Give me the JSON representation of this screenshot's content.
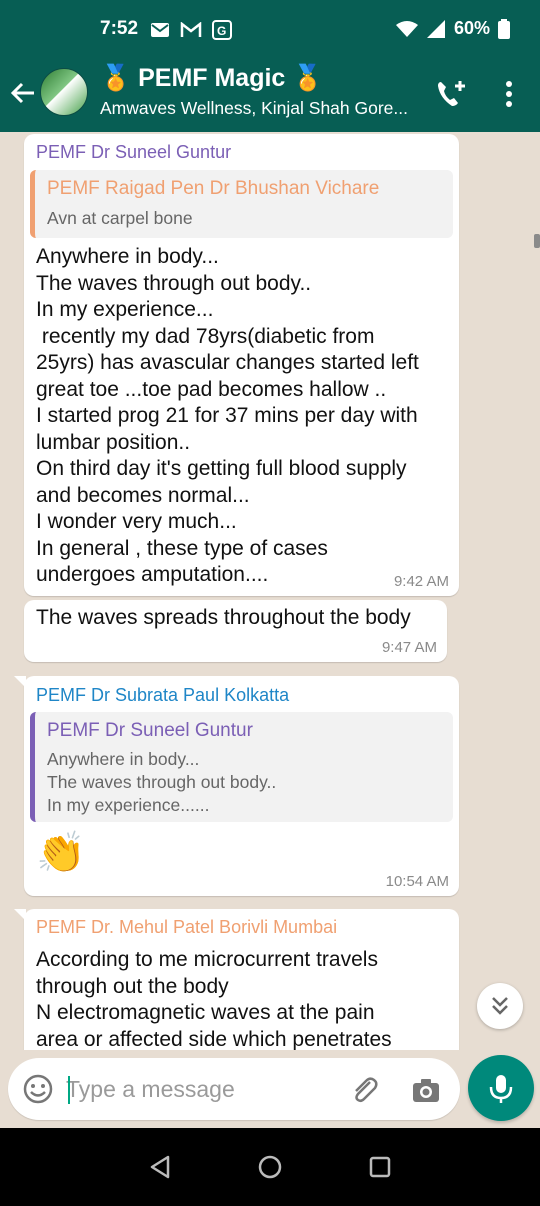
{
  "status_bar": {
    "time": "7:52",
    "battery": "60%"
  },
  "header": {
    "title": "PEMF Magic",
    "subtitle": "Amwaves Wellness, Kinjal Shah Gore..."
  },
  "messages": [
    {
      "sender": "PEMF Dr Suneel Guntur",
      "sender_color": "#7b5fb5",
      "quote": {
        "name": "PEMF Raigad Pen Dr Bhushan Vichare",
        "name_color": "#f0a071",
        "text": [
          "Avn at carpel bone"
        ]
      },
      "text": [
        "Anywhere in body...",
        "The waves through out body..",
        "In my experience...",
        " recently my dad 78yrs(diabetic from",
        "25yrs) has avascular changes started left",
        "great toe ...toe pad becomes hallow ..",
        "I started prog 21 for 37 mins per day with",
        "lumbar position..",
        "On third day it's getting full blood supply",
        "and becomes normal...",
        "I wonder very much...",
        "In general , these type of cases",
        "undergoes amputation...."
      ],
      "time": "9:42 AM"
    },
    {
      "text": [
        "The waves spreads throughout the body"
      ],
      "time": "9:47 AM"
    },
    {
      "sender": "PEMF Dr Subrata Paul Kolkatta",
      "sender_color": "#1f86c7",
      "quote": {
        "name": "PEMF Dr Suneel Guntur",
        "name_color": "#7b5fb5",
        "text": [
          "Anywhere in body...",
          "The waves through out body..",
          "In my experience......"
        ]
      },
      "emoji": "👏",
      "time": "10:54 AM"
    },
    {
      "sender": "PEMF Dr. Mehul Patel Borivli Mumbai",
      "sender_color": "#f0a071",
      "text": [
        "According to me microcurrent travels",
        "through out the body",
        "N electromagnetic waves at the pain",
        "area or affected side which penetrates"
      ]
    }
  ],
  "input": {
    "placeholder": "Type a message"
  },
  "colors": {
    "header": "#075e54",
    "accent": "#00897b",
    "chat_bg": "#e7ddd2"
  },
  "icons": [
    "back-arrow-icon",
    "medal-icon",
    "add-call-icon",
    "more-vert-icon",
    "emoji-icon",
    "attach-icon",
    "camera-icon",
    "mic-icon",
    "double-chevron-down-icon",
    "nav-back-icon",
    "nav-home-icon",
    "nav-recents-icon",
    "wifi-icon",
    "signal-icon",
    "battery-icon",
    "mail-icon",
    "gmail-icon",
    "translate-icon"
  ]
}
